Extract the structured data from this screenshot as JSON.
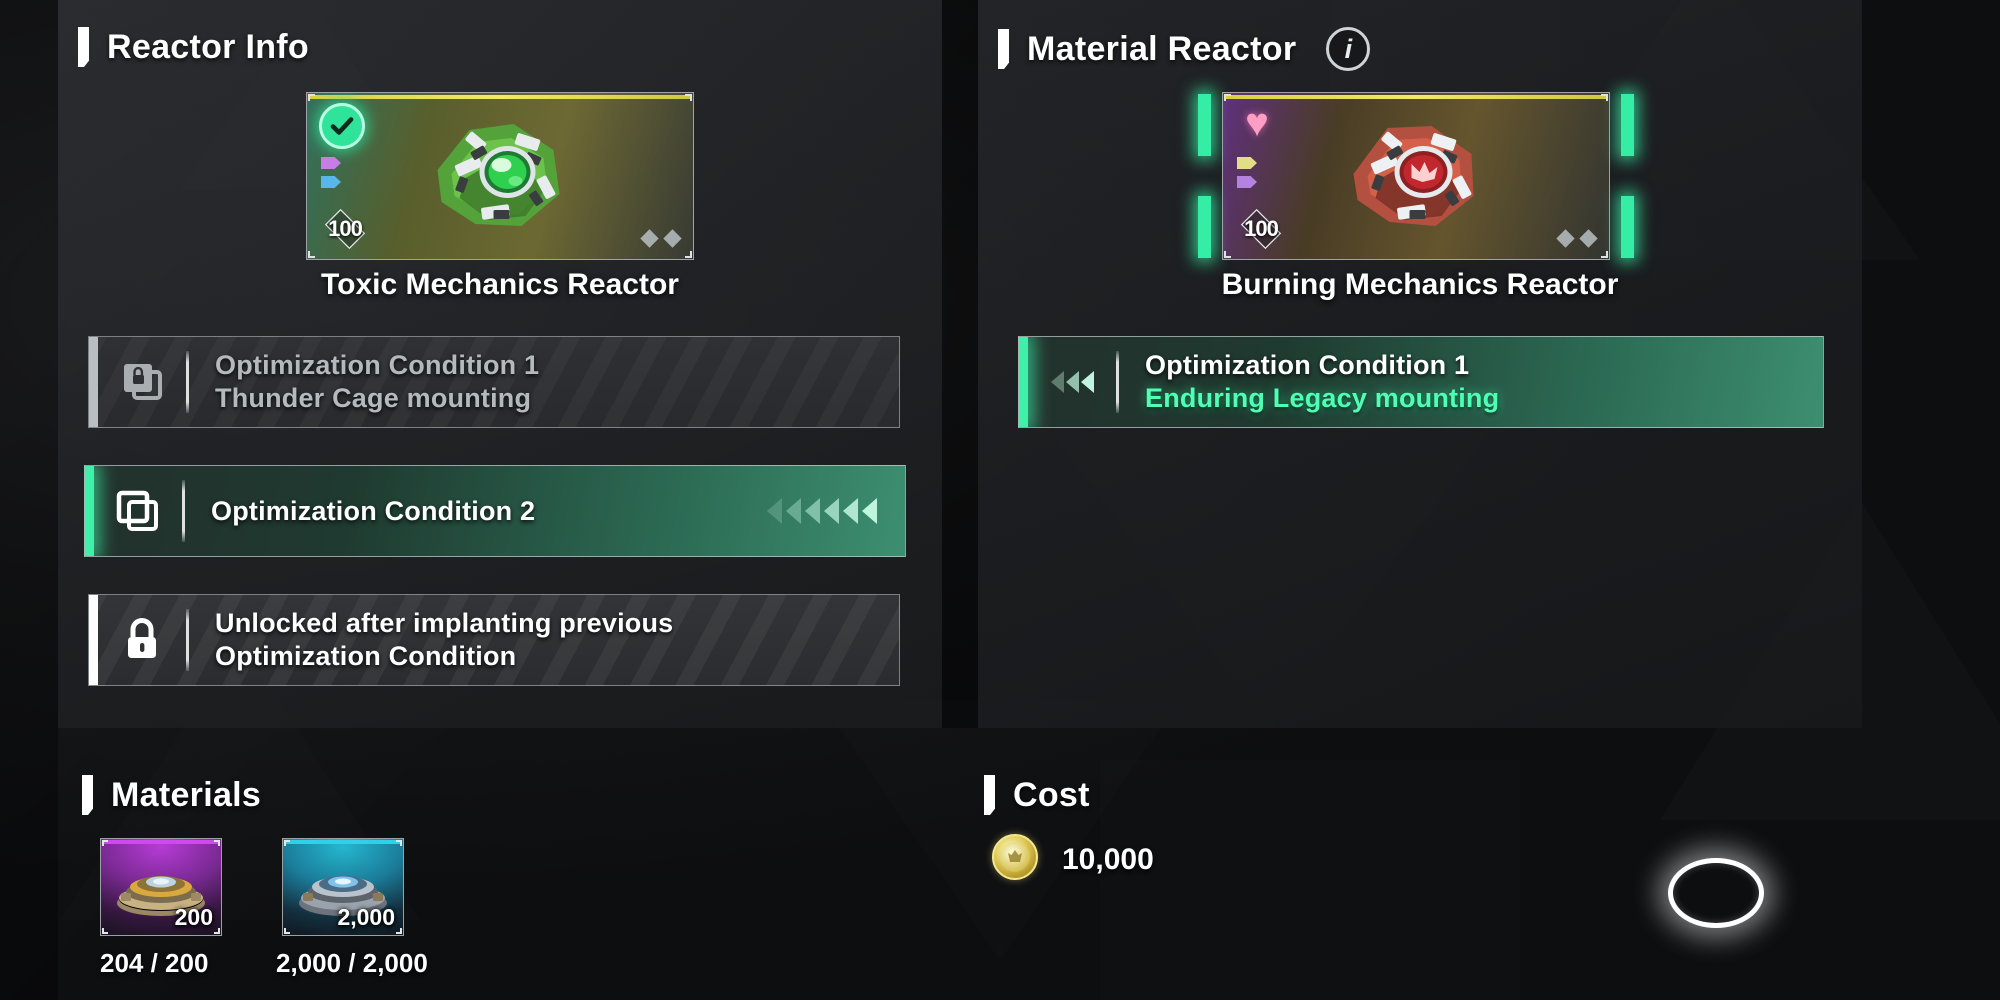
{
  "reactor_info": {
    "title": "Reactor Info",
    "reactor_name": "Toxic Mechanics Reactor",
    "level": "100",
    "status_icon": "check-icon",
    "conditions": [
      {
        "icon": "locked-stack-icon",
        "line1": "Optimization Condition 1",
        "line2": "Thunder Cage mounting",
        "state": "locked"
      },
      {
        "icon": "stack-icon",
        "line1": "Optimization Condition 2",
        "line2": "",
        "state": "active"
      },
      {
        "icon": "padlock-icon",
        "line1": "Unlocked after implanting previous",
        "line2": "Optimization Condition",
        "state": "sealed"
      }
    ]
  },
  "material_reactor": {
    "title": "Material Reactor",
    "info_icon": "info-icon",
    "info_glyph": "i",
    "reactor_name": "Burning Mechanics Reactor",
    "level": "100",
    "status_icon": "heart-icon",
    "conditions": [
      {
        "icon": "arrows-left-icon",
        "line1": "Optimization Condition 1",
        "line2": "Enduring Legacy mounting",
        "state": "active"
      }
    ]
  },
  "materials": {
    "title": "Materials",
    "items": [
      {
        "tier": "purple",
        "qty_label": "200",
        "count_label": "204 / 200",
        "art": "reactor-core-gold"
      },
      {
        "tier": "blue",
        "qty_label": "2,000",
        "count_label": "2,000 / 2,000",
        "art": "reactor-core-blue"
      }
    ]
  },
  "cost": {
    "title": "Cost",
    "currency_icon": "gold-coin-icon",
    "amount": "10,000"
  },
  "action": {
    "button_icon": "confirm-ring-icon"
  },
  "colors": {
    "accent_green": "#3ef0a8",
    "active_text": "#4fffb4",
    "locked_text": "#b4b9bd",
    "purple_tier": "#d049ee",
    "blue_tier": "#2fd0e8",
    "gold": "#e2cf5e"
  }
}
